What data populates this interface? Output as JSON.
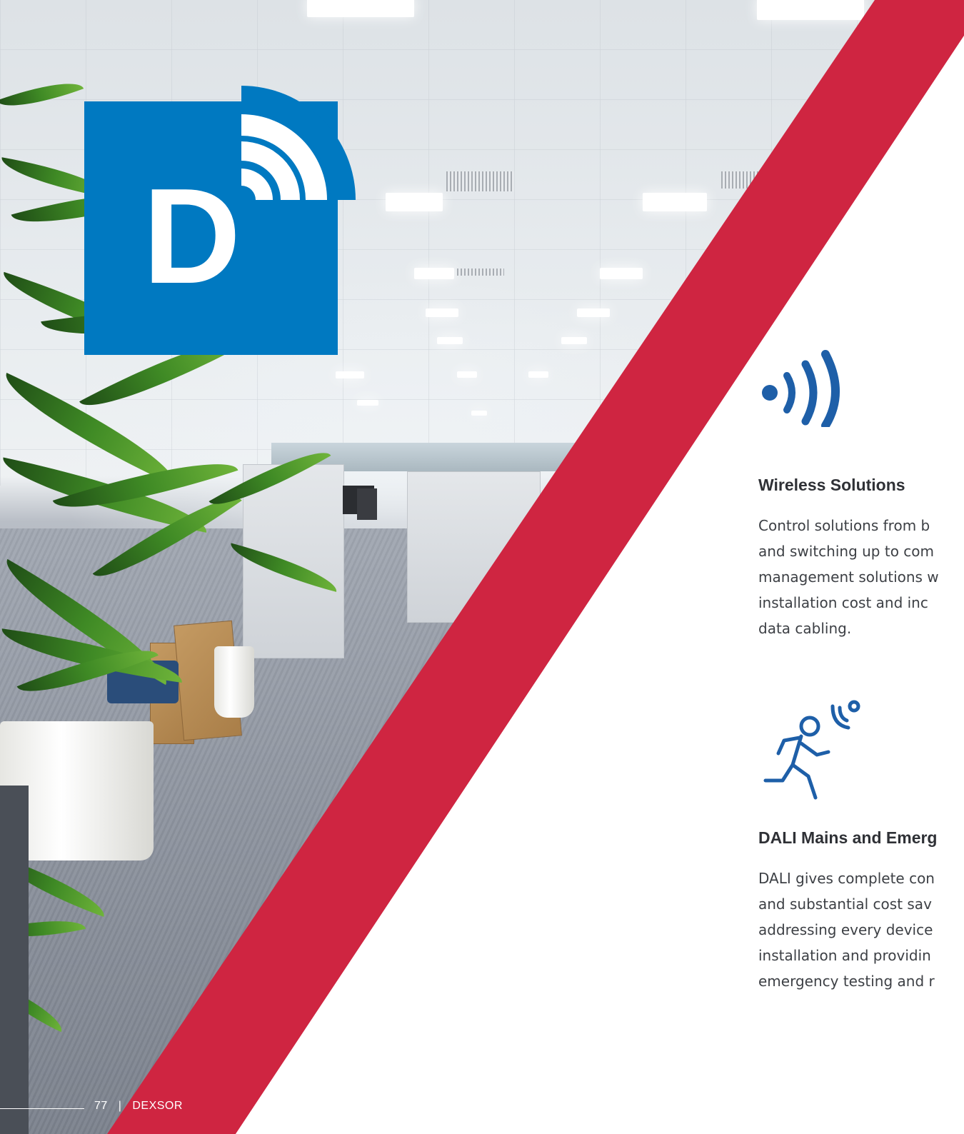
{
  "logo": {
    "letter": "D",
    "color": "#0079c1"
  },
  "colors": {
    "accent_red": "#cf2541",
    "icon_blue": "#1e5fa8",
    "heading": "#2f3136",
    "body": "#3d4045"
  },
  "footer": {
    "page_number": "77",
    "separator": "|",
    "brand": "DEXSOR"
  },
  "features": [
    {
      "icon": "wireless-signal-icon",
      "title": "Wireless Solutions",
      "lines": [
        "Control solutions from b",
        "and switching up to com",
        "management solutions w",
        "installation cost and inc",
        "data cabling."
      ]
    },
    {
      "icon": "motion-sensor-person-icon",
      "title": "DALI Mains and Emerg",
      "lines": [
        "DALI gives complete con",
        "and substantial cost sav",
        "addressing every device",
        "installation and providin",
        "emergency testing and r"
      ]
    }
  ]
}
